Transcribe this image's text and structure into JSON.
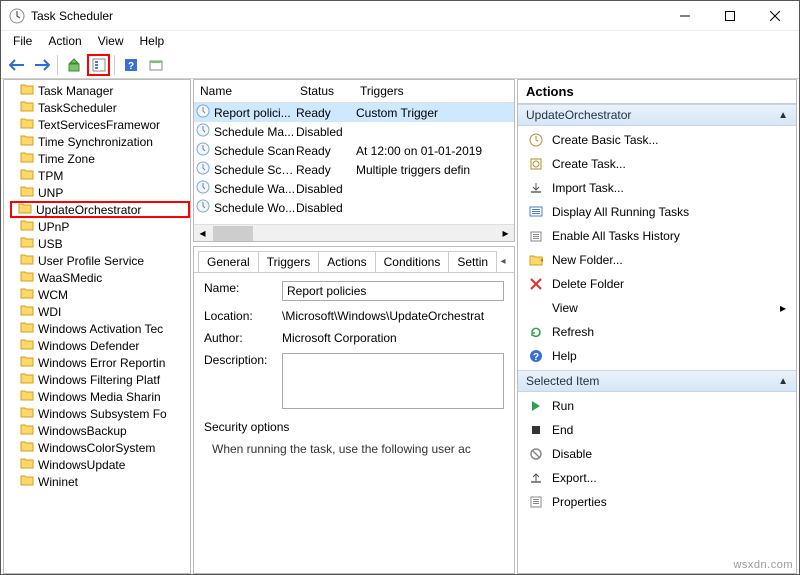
{
  "window": {
    "title": "Task Scheduler"
  },
  "menu": [
    "File",
    "Action",
    "View",
    "Help"
  ],
  "tree": [
    {
      "label": "Task Manager"
    },
    {
      "label": "TaskScheduler"
    },
    {
      "label": "TextServicesFramewor"
    },
    {
      "label": "Time Synchronization"
    },
    {
      "label": "Time Zone"
    },
    {
      "label": "TPM"
    },
    {
      "label": "UNP"
    },
    {
      "label": "UpdateOrchestrator",
      "highlight": true
    },
    {
      "label": "UPnP"
    },
    {
      "label": "USB"
    },
    {
      "label": "User Profile Service"
    },
    {
      "label": "WaaSMedic"
    },
    {
      "label": "WCM"
    },
    {
      "label": "WDI"
    },
    {
      "label": "Windows Activation Tec"
    },
    {
      "label": "Windows Defender"
    },
    {
      "label": "Windows Error Reportin"
    },
    {
      "label": "Windows Filtering Platf"
    },
    {
      "label": "Windows Media Sharin"
    },
    {
      "label": "Windows Subsystem Fo"
    },
    {
      "label": "WindowsBackup"
    },
    {
      "label": "WindowsColorSystem"
    },
    {
      "label": "WindowsUpdate"
    },
    {
      "label": "Wininet"
    }
  ],
  "task_columns": [
    "Name",
    "Status",
    "Triggers"
  ],
  "tasks": [
    {
      "name": "Report polici...",
      "status": "Ready",
      "triggers": "Custom Trigger",
      "selected": true
    },
    {
      "name": "Schedule Ma...",
      "status": "Disabled",
      "triggers": ""
    },
    {
      "name": "Schedule Scan",
      "status": "Ready",
      "triggers": "At 12:00 on 01-01-2019"
    },
    {
      "name": "Schedule Sca...",
      "status": "Ready",
      "triggers": "Multiple triggers defin"
    },
    {
      "name": "Schedule Wa...",
      "status": "Disabled",
      "triggers": ""
    },
    {
      "name": "Schedule Wo...",
      "status": "Disabled",
      "triggers": ""
    }
  ],
  "detail_tabs": [
    "General",
    "Triggers",
    "Actions",
    "Conditions",
    "Settin"
  ],
  "detail": {
    "name_label": "Name:",
    "name_value": "Report policies",
    "location_label": "Location:",
    "location_value": "\\Microsoft\\Windows\\UpdateOrchestrat",
    "author_label": "Author:",
    "author_value": "Microsoft Corporation",
    "desc_label": "Description:",
    "desc_value": "",
    "security_label": "Security options",
    "security_text": "When running the task, use the following user ac"
  },
  "actions_panel": {
    "header": "Actions",
    "section1": "UpdateOrchestrator",
    "items1": [
      {
        "icon": "create-basic",
        "label": "Create Basic Task..."
      },
      {
        "icon": "create",
        "label": "Create Task..."
      },
      {
        "icon": "import",
        "label": "Import Task..."
      },
      {
        "icon": "display",
        "label": "Display All Running Tasks"
      },
      {
        "icon": "enable-hist",
        "label": "Enable All Tasks History"
      },
      {
        "icon": "folder",
        "label": "New Folder..."
      },
      {
        "icon": "delete",
        "label": "Delete Folder"
      },
      {
        "icon": "view",
        "label": "View",
        "submenu": true
      },
      {
        "icon": "refresh",
        "label": "Refresh"
      },
      {
        "icon": "help",
        "label": "Help"
      }
    ],
    "section2": "Selected Item",
    "items2": [
      {
        "icon": "run",
        "label": "Run"
      },
      {
        "icon": "end",
        "label": "End"
      },
      {
        "icon": "disable",
        "label": "Disable"
      },
      {
        "icon": "export",
        "label": "Export..."
      },
      {
        "icon": "props",
        "label": "Properties"
      }
    ]
  },
  "watermark": "wsxdn.com"
}
